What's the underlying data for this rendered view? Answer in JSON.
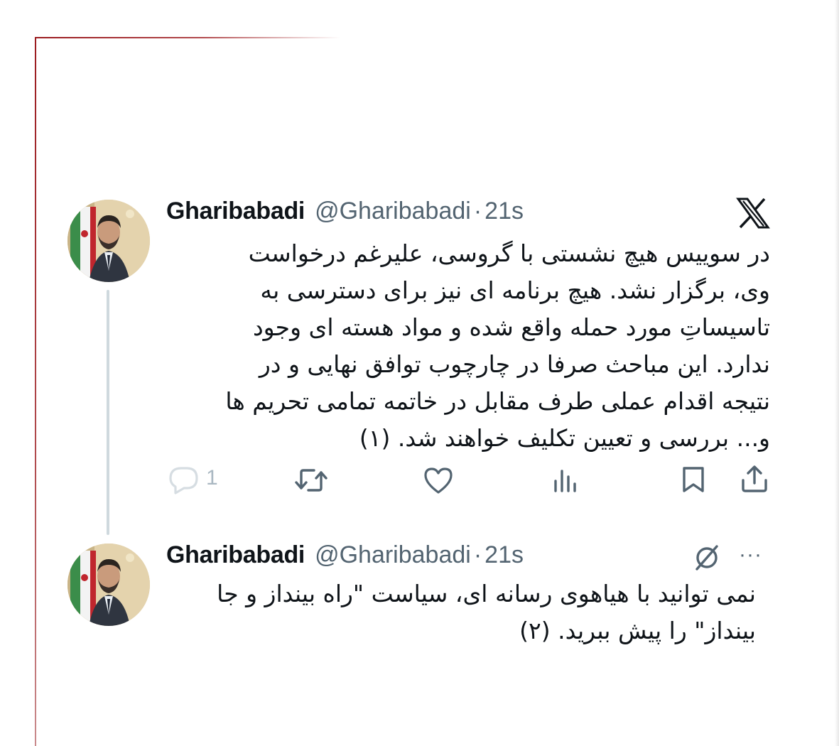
{
  "tweet1": {
    "name": "Gharibabadi",
    "handle": "@Gharibabadi",
    "separator": "·",
    "time": "21s",
    "lines": [
      "در سوییس هیچ نشستی با گروسی، علیرغم درخواست",
      "وی، برگزار نشد. هیچ برنامه ای نیز برای دسترسی به",
      "تاسیساتِ مورد حمله واقع شده و مواد هسته ای وجود",
      "ندارد. این مباحث صرفا در چارچوب توافق نهایی و در",
      "نتیجه اقدام عملی طرف مقابل در خاتمه تمامی تحریم ها",
      "و... بررسی و تعیین تکلیف خواهند شد. (۱)"
    ],
    "reply_count": "1"
  },
  "tweet2": {
    "name": "Gharibabadi",
    "handle": "@Gharibabadi",
    "separator": "·",
    "time": "21s",
    "more": "···",
    "lines": [
      "نمی توانید با هیاهوی رسانه ای، سیاست \"راه بینداز و جا",
      "بینداز\" را پیش ببرید. (۲)"
    ]
  },
  "colors": {
    "frame_accent": "#9b1b1f",
    "muted": "#536471",
    "thread_line": "#cfd9de"
  },
  "icons": [
    "x-logo-icon",
    "reply-icon",
    "retweet-icon",
    "like-icon",
    "views-icon",
    "bookmark-icon",
    "share-icon",
    "edit-slash-icon",
    "more-icon"
  ]
}
